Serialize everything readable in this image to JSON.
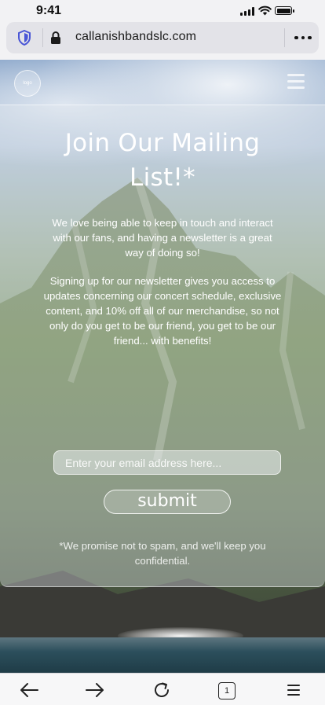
{
  "status": {
    "time": "9:41"
  },
  "browser": {
    "url": "callanishbandslc.com",
    "tab_count": "1"
  },
  "site": {
    "logo_text": "logo",
    "title": "Join Our Mailing List!*",
    "paragraph1": "We love being able to keep in touch and interact with our fans, and having a newsletter is a great way of doing so!",
    "paragraph2": "Signing up for our newsletter gives you access to updates concerning our concert schedule, exclusive content, and 10% off all of our merchandise, so not only do you get to be our friend, you get to be our friend... with benefits!",
    "email_placeholder": "Enter your email address here...",
    "submit_label": "submit",
    "disclaimer": "*We promise not to spam, and we'll keep you confidential."
  }
}
